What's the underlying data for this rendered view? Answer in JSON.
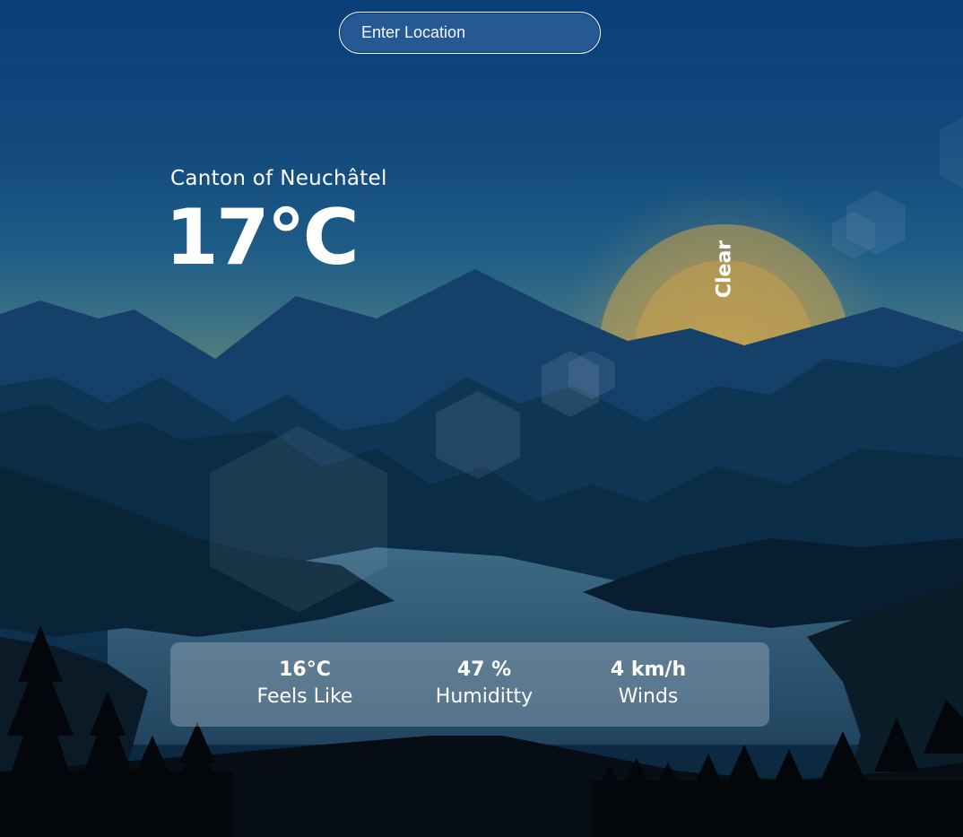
{
  "search": {
    "placeholder": "Enter Location",
    "value": ""
  },
  "weather": {
    "location": "Canton of Neuchâtel",
    "temperature": "17°C",
    "condition": "Clear"
  },
  "stats": [
    {
      "value": "16°C",
      "label": "Feels Like"
    },
    {
      "value": "47 %",
      "label": "Humiditty"
    },
    {
      "value": "4 km/h",
      "label": "Winds"
    }
  ],
  "colors": {
    "sky_top": "#0a3f7a",
    "horizon_glow": "#c8a04a",
    "foreground": "#04080d",
    "text": "#ffffff"
  }
}
